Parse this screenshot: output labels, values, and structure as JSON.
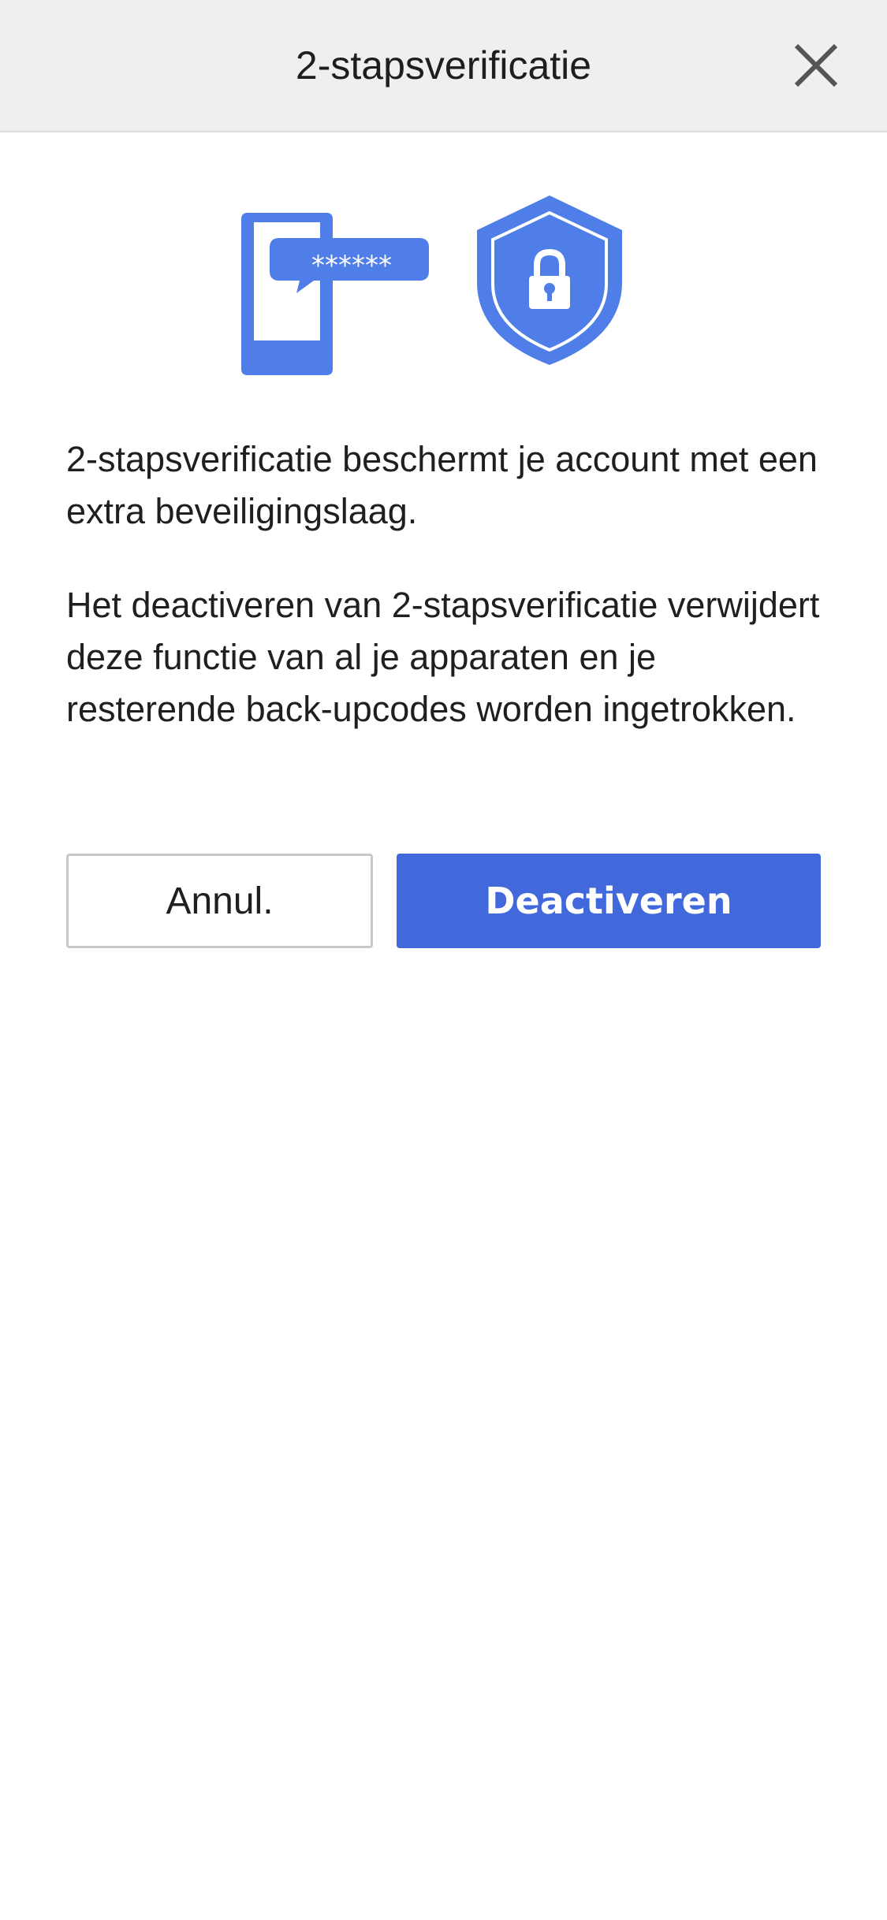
{
  "header": {
    "title": "2-stapsverificatie",
    "close_icon": "close-icon"
  },
  "illustration": {
    "phone_icon": "phone-message-icon",
    "shield_icon": "shield-lock-icon",
    "masked_code": "******",
    "accent_color": "#4f7ee8"
  },
  "body": {
    "paragraph_1": "2-stapsverificatie beschermt je account met een extra beveiligingslaag.",
    "paragraph_2": "Het deactiveren van 2-stapsverificatie verwijdert deze functie van al je apparaten en je resterende back-upcodes worden ingetrokken."
  },
  "actions": {
    "cancel_label": "Annul.",
    "deactivate_label": "Deactiveren",
    "primary_color": "#4169dc"
  }
}
